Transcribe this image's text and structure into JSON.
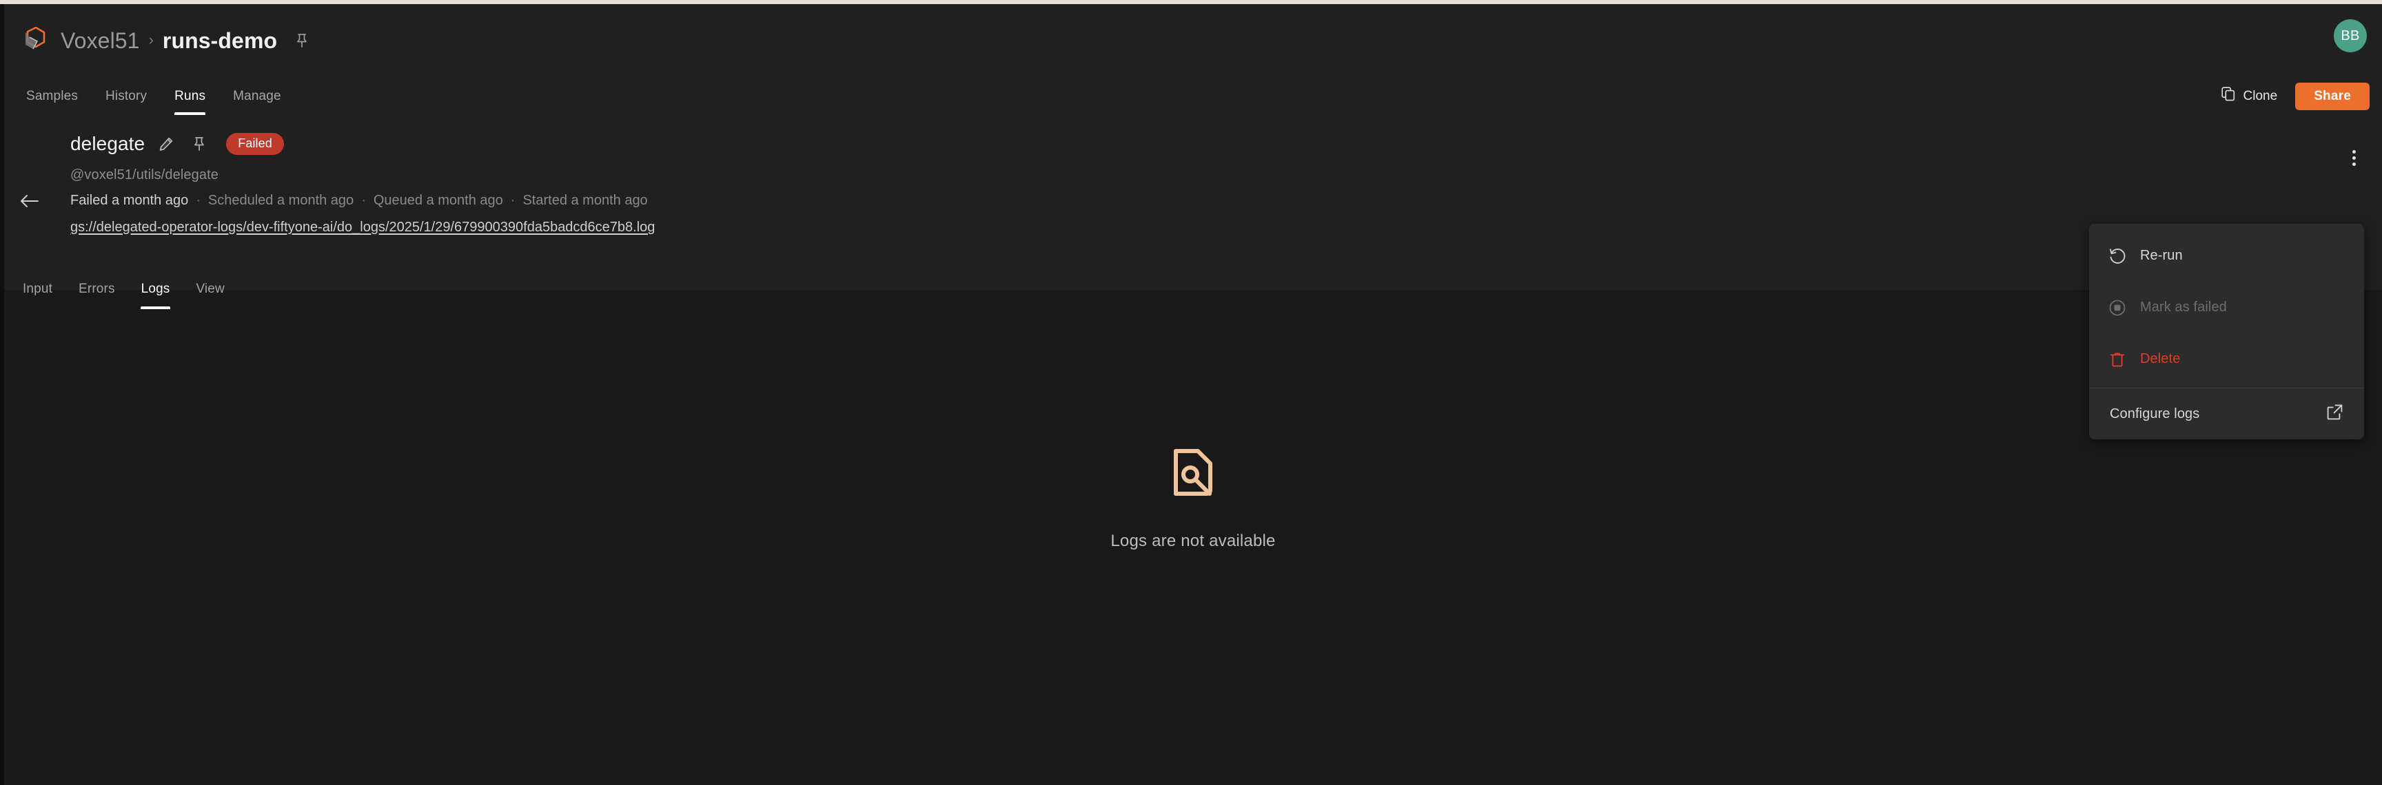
{
  "window": {
    "accent_orange": "#ed6f2e",
    "avatar_green": "#4ba088",
    "failed_red": "#c03a2b",
    "delete_red": "#e03b26",
    "empty_icon_color": "#f2c49b"
  },
  "header": {
    "logo_icon": "voxel51-logo-icon",
    "breadcrumb": {
      "org": "Voxel51",
      "separator": "›",
      "current": "runs-demo",
      "pin_icon": "pin-icon"
    },
    "avatar_initials": "BB",
    "tabs": [
      {
        "label": "Samples",
        "active": false
      },
      {
        "label": "History",
        "active": false
      },
      {
        "label": "Runs",
        "active": true
      },
      {
        "label": "Manage",
        "active": false
      }
    ],
    "clone": {
      "label": "Clone",
      "icon": "copy-icon"
    },
    "share": {
      "label": "Share"
    }
  },
  "run": {
    "back_icon": "arrow-left-icon",
    "name": "delegate",
    "edit_icon": "pencil-icon",
    "pin_icon": "pin-icon",
    "status": "Failed",
    "operator": "@voxel51/utils/delegate",
    "timeline": [
      {
        "label": "Failed a month ago",
        "primary": true
      },
      {
        "label": "Scheduled a month ago",
        "primary": false
      },
      {
        "label": "Queued a month ago",
        "primary": false
      },
      {
        "label": "Started a month ago",
        "primary": false
      }
    ],
    "timeline_separator": "·",
    "log_path": "gs://delegated-operator-logs/dev-fiftyone-ai/do_logs/2025/1/29/679900390fda5badcd6ce7b8.log",
    "kebab_icon": "more-vertical-icon",
    "sub_tabs": [
      {
        "label": "Input",
        "active": false
      },
      {
        "label": "Errors",
        "active": false
      },
      {
        "label": "Logs",
        "active": true
      },
      {
        "label": "View",
        "active": false
      }
    ]
  },
  "content": {
    "empty_icon": "document-search-icon",
    "empty_message": "Logs are not available"
  },
  "menu": {
    "items": [
      {
        "label": "Re-run",
        "icon": "rotate-ccw-icon",
        "kind": "rerun",
        "disabled": false
      },
      {
        "label": "Mark as failed",
        "icon": "stop-circle-icon",
        "kind": "markfailed",
        "disabled": true
      },
      {
        "label": "Delete",
        "icon": "trash-icon",
        "kind": "delete",
        "disabled": false
      }
    ],
    "footer": {
      "label": "Configure logs",
      "icon": "external-link-icon"
    }
  }
}
